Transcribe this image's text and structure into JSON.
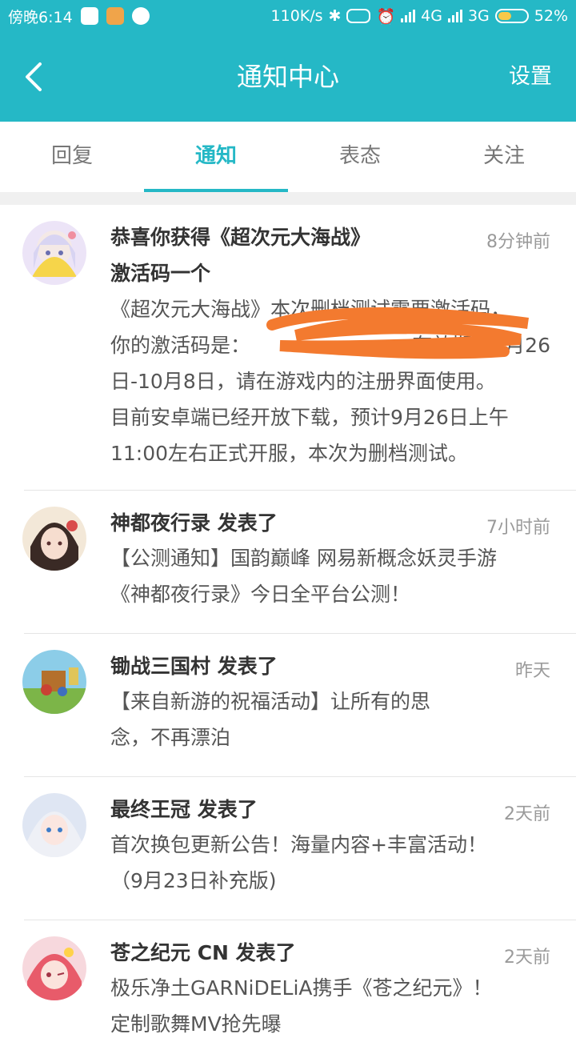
{
  "status_bar": {
    "time": "傍晚6:14",
    "speed": "110K/s",
    "network_4g": "4G",
    "network_3g": "3G",
    "battery": "52%",
    "battery_level": 0.52
  },
  "app_bar": {
    "title": "通知中心",
    "settings_label": "设置"
  },
  "tabs": [
    {
      "label": "回复",
      "active": false
    },
    {
      "label": "通知",
      "active": true
    },
    {
      "label": "表态",
      "active": false
    },
    {
      "label": "关注",
      "active": false
    }
  ],
  "notifications": [
    {
      "title_line1": "恭喜你获得《超次元大海战》",
      "title_line2": "激活码一个",
      "time": "8分钟前",
      "body": [
        "《超次元大海战》本次删档测试需要激活码，",
        "你的激活码是：",
        "有效期：9月26",
        "日-10月8日，请在游戏内的注册界面使用。",
        "目前安卓端已经开放下载，预计9月26日上午",
        "11:00左右正式开服，本次为删档测试。"
      ]
    },
    {
      "title": "神都夜行录 发表了",
      "time": "7小时前",
      "body": [
        "【公测通知】国韵巅峰 网易新概念妖灵手游",
        "《神都夜行录》今日全平台公测！"
      ]
    },
    {
      "title": "锄战三国村 发表了",
      "time": "昨天",
      "body": [
        "【来自新游的祝福活动】让所有的思",
        "念，不再漂泊"
      ]
    },
    {
      "title": "最终王冠 发表了",
      "time": "2天前",
      "body": [
        "首次换包更新公告！海量内容+丰富活动！",
        "（9月23日补充版)"
      ]
    },
    {
      "title": "苍之纪元 CN 发表了",
      "time": "2天前",
      "body": [
        "极乐净土GARNiDELiA携手《苍之纪元》！",
        "定制歌舞MV抢先曝"
      ]
    }
  ]
}
